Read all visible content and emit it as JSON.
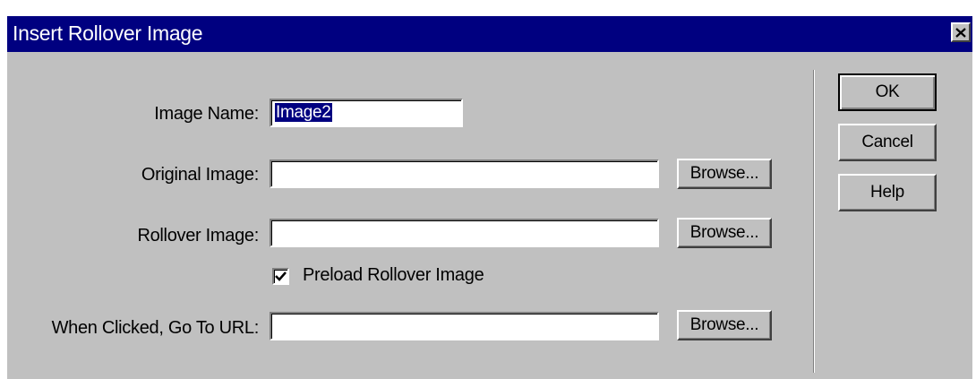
{
  "window": {
    "title": "Insert Rollover Image",
    "close_icon": "close-icon"
  },
  "fields": {
    "image_name": {
      "label": "Image Name:",
      "value": "Image2"
    },
    "original_image": {
      "label": "Original Image:",
      "value": ""
    },
    "rollover_image": {
      "label": "Rollover Image:",
      "value": ""
    },
    "url": {
      "label": "When Clicked, Go To URL:",
      "value": ""
    }
  },
  "preload": {
    "label": "Preload Rollover Image",
    "checked": true
  },
  "buttons": {
    "browse": "Browse...",
    "ok": "OK",
    "cancel": "Cancel",
    "help": "Help"
  },
  "colors": {
    "titlebar": "#000080",
    "dialog_bg": "#c0c0c0",
    "selection": "#000080"
  }
}
